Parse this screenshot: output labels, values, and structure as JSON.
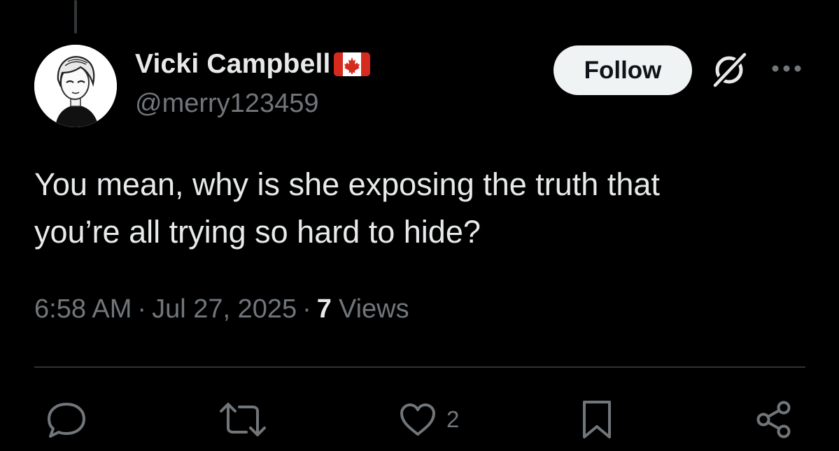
{
  "author": {
    "display_name": "Vicki Campbell",
    "handle": "@merry123459",
    "badge": "canada-flag-emoji"
  },
  "follow_label": "Follow",
  "tweet": {
    "text_line1": "You mean, why is she exposing the truth that",
    "text_line2": "you’re all trying so hard to hide?"
  },
  "meta": {
    "time": "6:58 AM",
    "separator": "·",
    "date": "Jul 27, 2025",
    "views_count": "7",
    "views_label": "Views"
  },
  "actions": {
    "reply_icon": "speech-bubble-icon",
    "repost_icon": "repost-arrows-icon",
    "like_icon": "heart-icon",
    "like_count": "2",
    "bookmark_icon": "bookmark-icon",
    "share_icon": "share-nodes-icon"
  },
  "colors": {
    "background": "#000000",
    "primary_text": "#e7e9ea",
    "secondary_text": "#71767b",
    "follow_button_bg": "#eff3f4",
    "divider": "#2f3336"
  }
}
